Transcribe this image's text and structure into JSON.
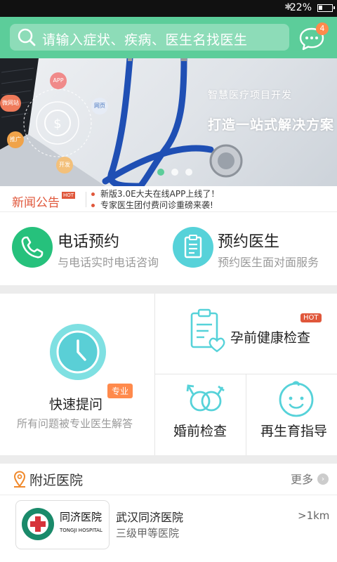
{
  "status_bar": {
    "battery": "22%"
  },
  "search": {
    "placeholder": "请输入症状、疾病、医生名找医生"
  },
  "chat": {
    "badge": "4"
  },
  "banner": {
    "subtitle": "智慧医疗项目开发",
    "title": "打造一站式解决方案",
    "hub_labels": [
      "APP",
      "网页",
      "微网站",
      "推广",
      "开发"
    ],
    "slide_count": 3,
    "active_slide": 1
  },
  "news": {
    "title": "新闻公告",
    "hot": "HOT",
    "items": [
      "新版3.0E大夫在线APP上线了！",
      "专家医生团付费问诊重磅来袭!"
    ]
  },
  "services": [
    {
      "title": "电话预约",
      "subtitle": "与电话实时电话咨询",
      "icon": "phone-icon",
      "color": "#26c17c"
    },
    {
      "title": "预约医生",
      "subtitle": "预约医生面对面服务",
      "icon": "clipboard-icon",
      "color": "#56d2d9"
    }
  ],
  "grid": {
    "quick": {
      "title": "快速提问",
      "tag": "专业",
      "subtitle": "所有问题被专业医生解答"
    },
    "prenatal": {
      "title": "孕前健康检查",
      "tag": "HOT"
    },
    "premarital": {
      "title": "婚前检查"
    },
    "fertility": {
      "title": "再生育指导"
    }
  },
  "nearby": {
    "title": "附近医院",
    "more": "更多",
    "hospitals": [
      {
        "name": "武汉同济医院",
        "grade": "三级甲等医院",
        "distance": ">1km",
        "logo_text": "同济医院",
        "logo_sub": "TONGJI HOSPITAL"
      }
    ]
  },
  "colors": {
    "brand": "#5ccd9a",
    "accent": "#e0573b",
    "tag": "#ff8a4c",
    "teal": "#56d2d9"
  }
}
